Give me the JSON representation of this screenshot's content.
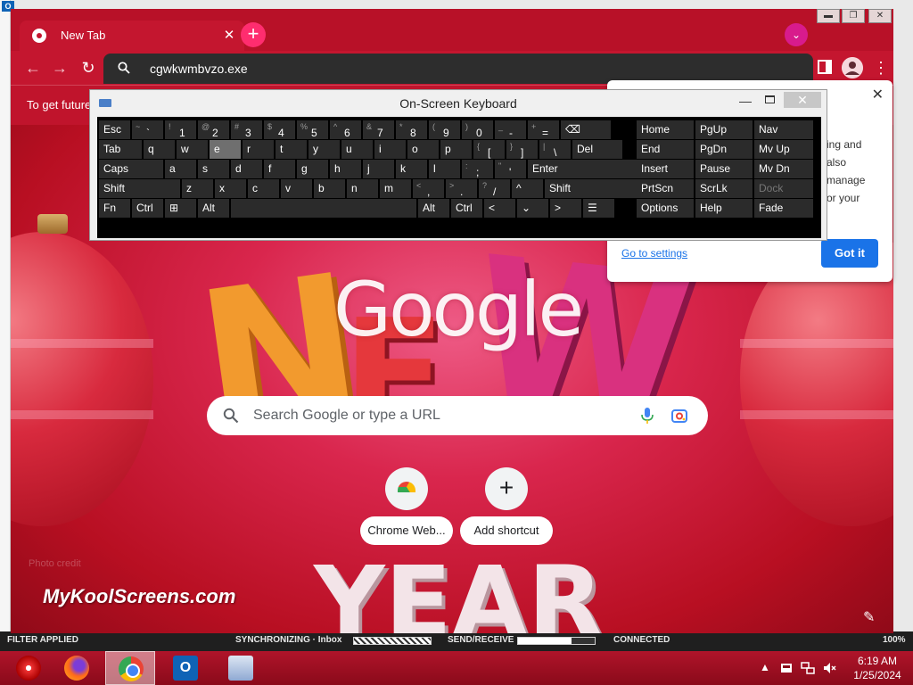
{
  "outlook_background": {
    "icon_letter": "O",
    "status": {
      "filter": "FILTER APPLIED",
      "sync": "SYNCHRONIZING · Inbox",
      "send_receive": "SEND/RECEIVE",
      "connection": "CONNECTED",
      "zoom": "100%"
    }
  },
  "chrome": {
    "tab": {
      "title": "New Tab",
      "close_glyph": "✕"
    },
    "new_tab_glyph": "+",
    "profile_dropdown_glyph": "⌄",
    "window_controls": {
      "minimize": "▬",
      "maximize": "❐",
      "close": "✕"
    },
    "toolbar": {
      "back": "←",
      "forward": "→",
      "refresh": "↻",
      "menu": "⋮"
    },
    "omnibox_text": "cgwkwmbvzo.exe",
    "info_bar_text": "To get future",
    "ntp": {
      "logo": "Google",
      "search_placeholder": "Search Google or type a URL",
      "shortcuts": [
        {
          "label": "Chrome Web..."
        },
        {
          "label": "Add shortcut",
          "glyph": "+"
        }
      ],
      "watermark": "MyKoolScreens.com",
      "photo_credit": "Photo credit",
      "customize_glyph": "✎"
    },
    "popup": {
      "close_glyph": "✕",
      "body_lines": [
        "ing and",
        "also",
        "manage",
        "or your"
      ],
      "link": "Go to settings",
      "button": "Got it"
    }
  },
  "osk": {
    "title": "On-Screen Keyboard",
    "min_glyph": "—",
    "close_glyph": "✕",
    "rows": [
      [
        {
          "main": "Esc"
        },
        {
          "shift": "~",
          "main": "`"
        },
        {
          "shift": "!",
          "main": "1"
        },
        {
          "shift": "@",
          "main": "2"
        },
        {
          "shift": "#",
          "main": "3"
        },
        {
          "shift": "$",
          "main": "4"
        },
        {
          "shift": "%",
          "main": "5"
        },
        {
          "shift": "^",
          "main": "6"
        },
        {
          "shift": "&",
          "main": "7"
        },
        {
          "shift": "*",
          "main": "8"
        },
        {
          "shift": "(",
          "main": "9"
        },
        {
          "shift": ")",
          "main": "0"
        },
        {
          "shift": "_",
          "main": "-"
        },
        {
          "shift": "+",
          "main": "="
        },
        {
          "main": "⌫"
        },
        {
          "main": "Home"
        },
        {
          "main": "PgUp"
        },
        {
          "main": "Nav"
        }
      ],
      [
        {
          "main": "Tab"
        },
        {
          "main": "q"
        },
        {
          "main": "w"
        },
        {
          "main": "e",
          "highlight": true
        },
        {
          "main": "r"
        },
        {
          "main": "t"
        },
        {
          "main": "y"
        },
        {
          "main": "u"
        },
        {
          "main": "i"
        },
        {
          "main": "o"
        },
        {
          "main": "p"
        },
        {
          "shift": "{",
          "main": "["
        },
        {
          "shift": "}",
          "main": "]"
        },
        {
          "shift": "|",
          "main": "\\"
        },
        {
          "main": "Del"
        },
        {
          "main": "End"
        },
        {
          "main": "PgDn"
        },
        {
          "main": "Mv Up"
        }
      ],
      [
        {
          "main": "Caps"
        },
        {
          "main": "a"
        },
        {
          "main": "s"
        },
        {
          "main": "d"
        },
        {
          "main": "f"
        },
        {
          "main": "g"
        },
        {
          "main": "h"
        },
        {
          "main": "j"
        },
        {
          "main": "k"
        },
        {
          "main": "l"
        },
        {
          "shift": ":",
          "main": ";"
        },
        {
          "shift": "\"",
          "main": "'"
        },
        {
          "main": "Enter"
        },
        {
          "main": "Insert"
        },
        {
          "main": "Pause"
        },
        {
          "main": "Mv Dn"
        }
      ],
      [
        {
          "main": "Shift"
        },
        {
          "main": "z"
        },
        {
          "main": "x"
        },
        {
          "main": "c"
        },
        {
          "main": "v"
        },
        {
          "main": "b"
        },
        {
          "main": "n"
        },
        {
          "main": "m"
        },
        {
          "shift": "<",
          "main": ","
        },
        {
          "shift": ">",
          "main": "."
        },
        {
          "shift": "?",
          "main": "/"
        },
        {
          "main": "^"
        },
        {
          "main": "Shift"
        },
        {
          "main": "PrtScn"
        },
        {
          "main": "ScrLk"
        },
        {
          "main": "Dock",
          "dim": true
        }
      ],
      [
        {
          "main": "Fn"
        },
        {
          "main": "Ctrl"
        },
        {
          "main": "⊞"
        },
        {
          "main": "Alt"
        },
        {
          "main": ""
        },
        {
          "main": "Alt"
        },
        {
          "main": "Ctrl"
        },
        {
          "main": "<"
        },
        {
          "main": "⌄"
        },
        {
          "main": ">"
        },
        {
          "main": "☰"
        },
        {
          "main": "Options"
        },
        {
          "main": "Help"
        },
        {
          "main": "Fade"
        }
      ]
    ]
  },
  "taskbar": {
    "apps": [
      {
        "name": "start"
      },
      {
        "name": "firefox"
      },
      {
        "name": "chrome",
        "active": true
      },
      {
        "name": "outlook",
        "letter": "O"
      },
      {
        "name": "osk"
      }
    ],
    "tray": {
      "show_hidden": "▲",
      "time": "6:19 AM",
      "date": "1/25/2024"
    }
  }
}
